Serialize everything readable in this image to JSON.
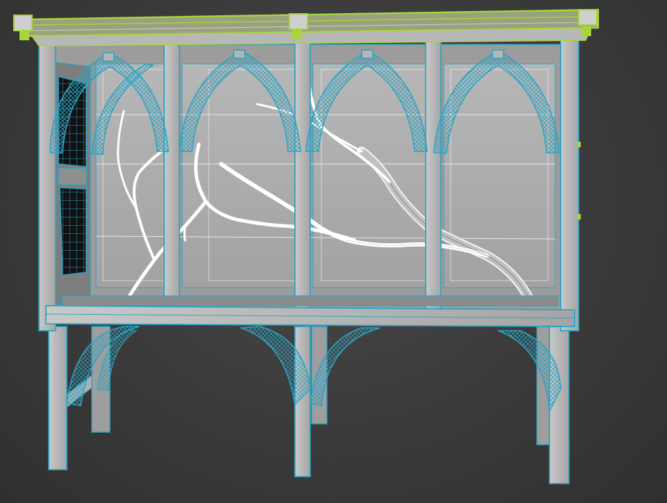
{
  "viewport": {
    "background_color": "#3c3c3c",
    "shaded_color": "#a9a9a9",
    "wire_selected_color": "#2fa3c2",
    "wire_highlight_color": "#a7d63a",
    "wire_mesh_color": "#ffffff"
  },
  "scene": {
    "objects": [
      {
        "name": "top-cornice",
        "state": "highlighted"
      },
      {
        "name": "cabinet-frame",
        "state": "selected"
      },
      {
        "name": "gothic-arches",
        "state": "selected"
      },
      {
        "name": "glass-panels",
        "state": "shaded"
      },
      {
        "name": "tree-branch",
        "state": "wireframe"
      },
      {
        "name": "leaded-side-window",
        "state": "selected"
      },
      {
        "name": "base-legs",
        "state": "selected"
      }
    ]
  }
}
